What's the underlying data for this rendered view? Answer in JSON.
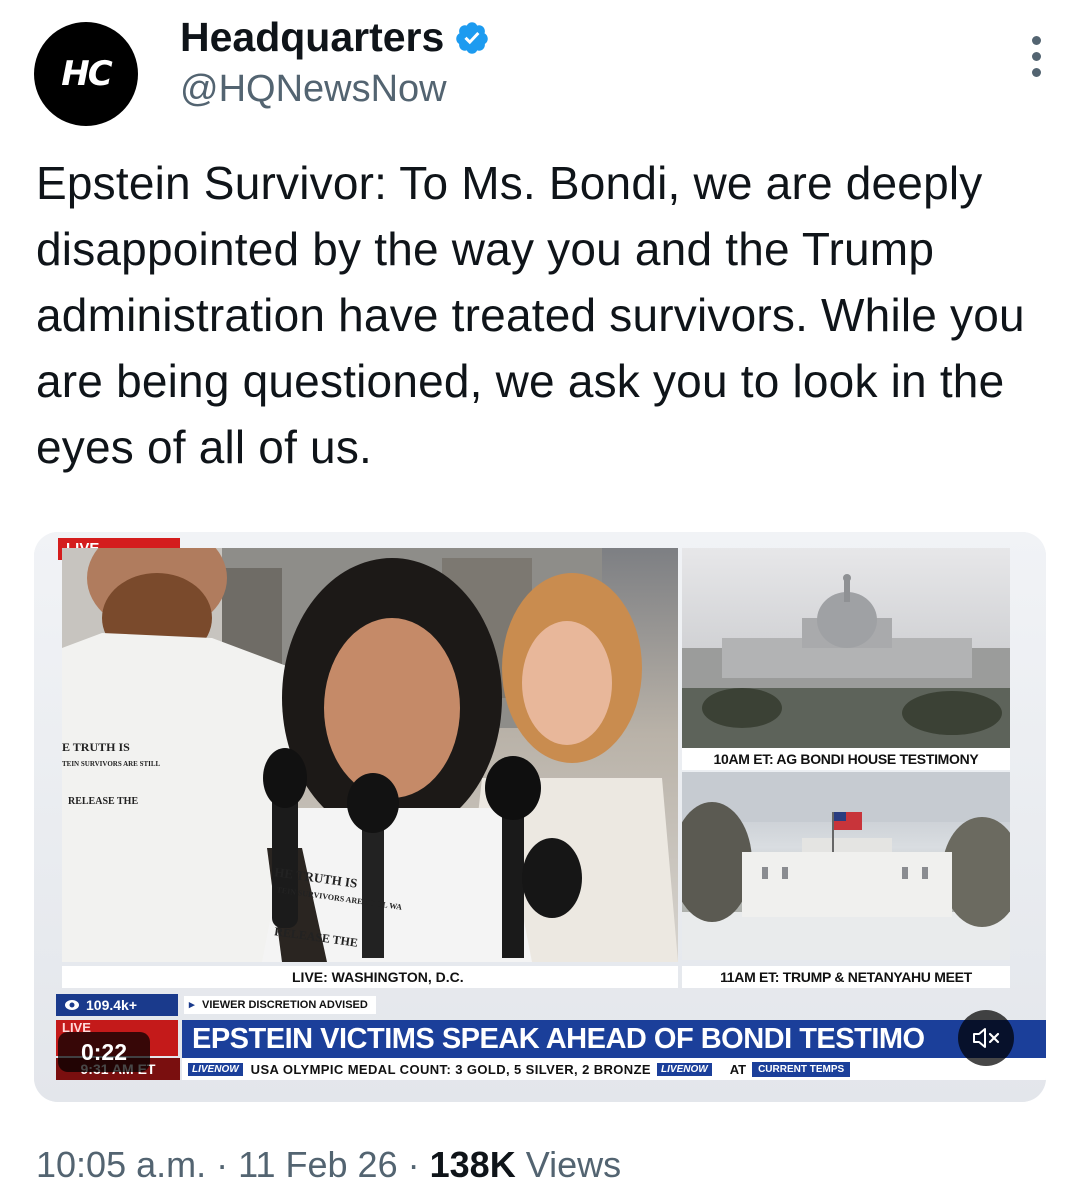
{
  "author": {
    "avatar_text": "HC",
    "display_name": "Headquarters",
    "handle": "@HQNewsNow",
    "verified": true
  },
  "post": {
    "text": "Epstein Survivor: To Ms. Bondi, we are deeply disappointed by the way you and the Trump administration have treated survivors. While you are being questioned, we ask you to look in the eyes of all of us."
  },
  "video": {
    "live_tag": "LIVE",
    "side_top_label": "10AM ET: AG BONDI HOUSE TESTIMONY",
    "main_label": "LIVE: WASHINGTON, D.C.",
    "side_bottom_label": "11AM ET: TRUMP & NETANYAHU MEET",
    "views_badge": "109.4k+",
    "discretion": "VIEWER DISCRETION ADVISED",
    "live_box": "LIVE",
    "headline": "EPSTEIN VICTIMS SPEAK AHEAD OF BONDI TESTIMO",
    "clock": "9:31 AM ET",
    "ticker_tag": "LIVENOW",
    "ticker_text": "USA OLYMPIC MEDAL COUNT: 3 GOLD, 5 SILVER, 2 BRONZE",
    "ticker_tag_2": "LIVENOW",
    "ticker_at": "AT",
    "ticker_temps": "CURRENT TEMPS",
    "duration": "0:22",
    "muted": true,
    "shirt_text_1": "HE TRUTH IS",
    "shirt_text_2": "TEIN SURVIVORS ARE STILL WA",
    "shirt_text_3": "RELEASE THE",
    "left_shirt_1": "E TRUTH IS",
    "left_shirt_2": "TEIN SURVIVORS ARE STILL",
    "left_shirt_3": "RELEASE THE"
  },
  "meta": {
    "time": "10:05 a.m.",
    "sep1": "·",
    "date": "11 Feb 26",
    "sep2": "·",
    "views": "138K",
    "views_label": "Views"
  },
  "colors": {
    "verified": "#1d9bf0",
    "news_blue": "#1b3f9a",
    "live_red": "#d41d1d"
  }
}
